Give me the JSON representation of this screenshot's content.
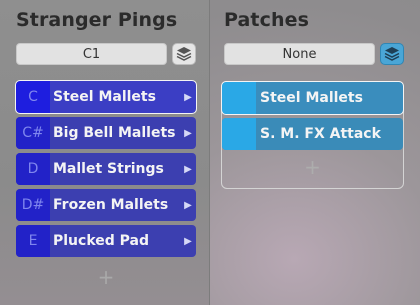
{
  "left": {
    "title": "Stranger Pings",
    "selector_value": "C1",
    "items": [
      {
        "note": "C",
        "label": "Steel Mallets",
        "selected": true
      },
      {
        "note": "C#",
        "label": "Big Bell Mallets",
        "selected": false
      },
      {
        "note": "D",
        "label": "Mallet Strings",
        "selected": false
      },
      {
        "note": "D#",
        "label": "Frozen Mallets",
        "selected": false
      },
      {
        "note": "E",
        "label": "Plucked Pad",
        "selected": false
      }
    ],
    "add_label": "+"
  },
  "right": {
    "title": "Patches",
    "selector_value": "None",
    "patches": [
      {
        "label": "Steel Mallets",
        "selected": true
      },
      {
        "label": "S. M. FX Attack",
        "selected": false
      }
    ],
    "add_label": "+"
  },
  "colors": {
    "item_bg": "#3c3fb0",
    "note_bg": "#2222c8",
    "patch_bg": "#3a8bb8",
    "patch_color": "#2aa8e6",
    "layer_active": "#4aa6d6"
  },
  "icons": {
    "layers": "layers-icon",
    "arrow": "triangle-right-icon",
    "add": "plus-icon"
  }
}
